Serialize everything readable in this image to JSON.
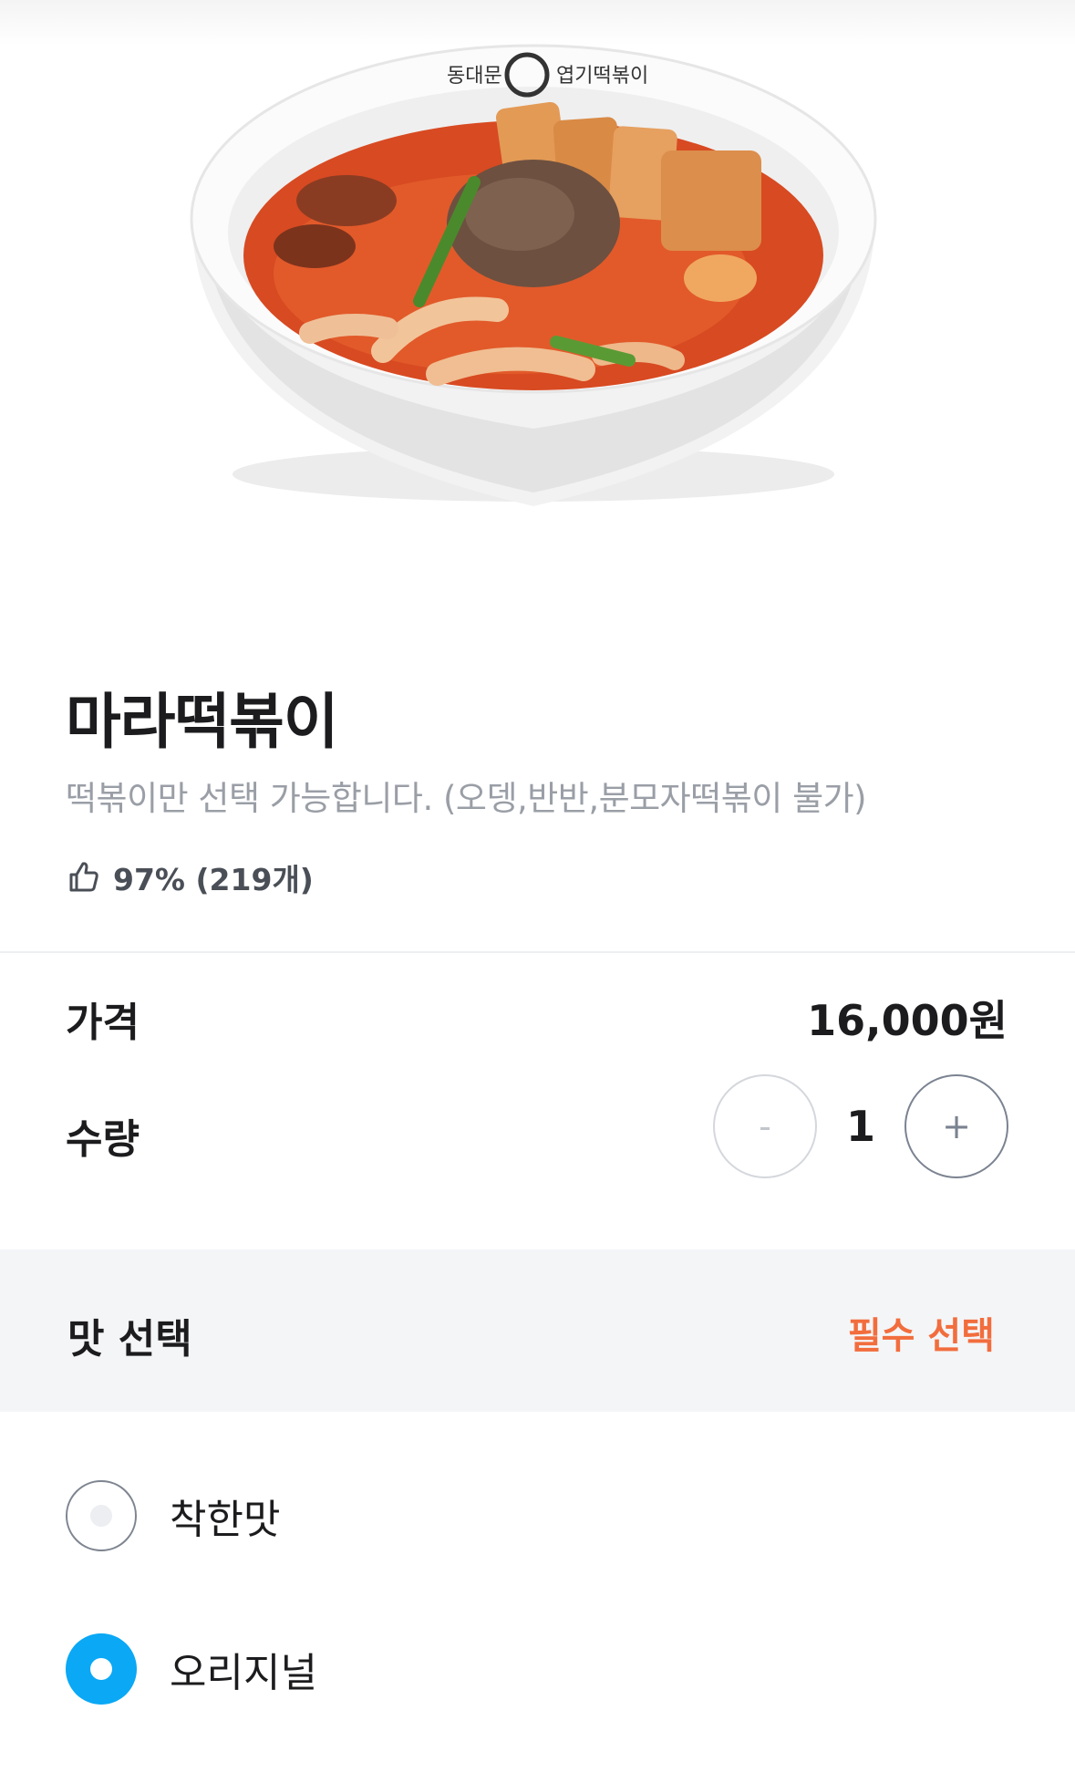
{
  "menu": {
    "name": "마라떡볶이",
    "description": "떡볶이만 선택 가능합니다. (오뎅,반반,분모자떡볶이 불가)",
    "rating_text": "97% (219개)",
    "bowl_brand_text": "동대문엽기떡볶이"
  },
  "price": {
    "label": "가격",
    "value": "16,000원"
  },
  "quantity": {
    "label": "수량",
    "value": "1",
    "minus": "-",
    "plus": "+"
  },
  "option_group": {
    "title": "맛 선택",
    "required_label": "필수 선택",
    "options": [
      {
        "label": "착한맛",
        "selected": false
      },
      {
        "label": "오리지널",
        "selected": true
      }
    ]
  },
  "colors": {
    "accent_orange": "#f26d3d",
    "radio_selected": "#0aa8f5",
    "muted_text": "#9a9ea6",
    "section_bg": "#f4f5f7"
  },
  "icons": {
    "rating": "thumbs-up-icon"
  }
}
